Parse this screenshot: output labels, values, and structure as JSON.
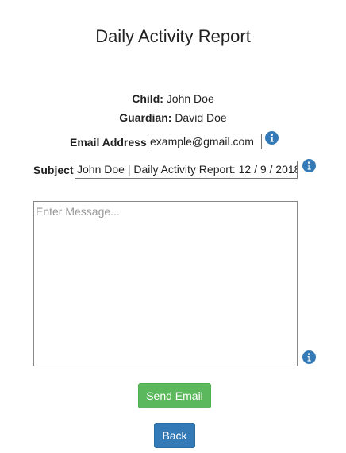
{
  "page": {
    "title": "Daily Activity Report"
  },
  "info": {
    "child_label": "Child:",
    "child_name": "John Doe",
    "guardian_label": "Guardian:",
    "guardian_name": "David Doe"
  },
  "form": {
    "email_label": "Email Address:",
    "email_value": "example@gmail.com",
    "subject_label": "Subject:",
    "subject_value": "John Doe | Daily Activity Report: 12 / 9 / 2018",
    "message_placeholder": "Enter Message...",
    "message_value": ""
  },
  "buttons": {
    "send_label": "Send Email",
    "back_label": "Back"
  },
  "icons": {
    "info_icon": "info-circle",
    "info_color": "#337ab7"
  },
  "colors": {
    "send_button": "#5cb85c",
    "back_button": "#337ab7"
  }
}
